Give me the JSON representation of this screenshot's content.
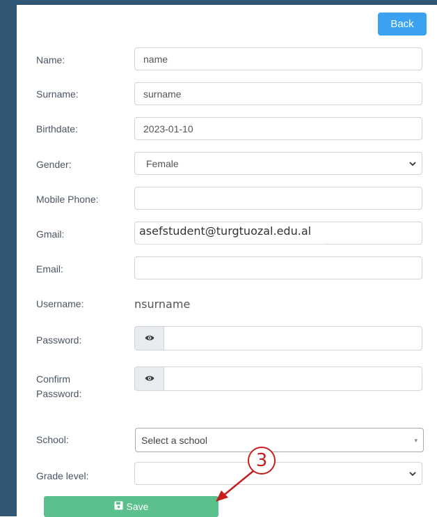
{
  "header": {
    "back_label": "Back"
  },
  "form": {
    "name": {
      "label": "Name:",
      "value": "name"
    },
    "surname": {
      "label": "Surname:",
      "value": "surname"
    },
    "birthdate": {
      "label": "Birthdate:",
      "value": "2023-01-10"
    },
    "gender": {
      "label": "Gender:",
      "value": "Female"
    },
    "mobile_phone": {
      "label": "Mobile Phone:",
      "value": ""
    },
    "gmail": {
      "label": "Gmail:",
      "value": "asefstudent@turgtuozal.edu.al"
    },
    "email": {
      "label": "Email:",
      "value": ""
    },
    "username": {
      "label": "Username:",
      "value": "nsurname"
    },
    "password": {
      "label": "Password:"
    },
    "confirm_password": {
      "label_line1": "Confirm",
      "label_line2": "Password:"
    },
    "school": {
      "label": "School:",
      "placeholder": "Select a school"
    },
    "grade_level": {
      "label": "Grade level:",
      "value": ""
    },
    "save_label": "Save"
  },
  "annotation": {
    "step": "3"
  },
  "colors": {
    "rail": "#2f5775",
    "back_button": "#3aa2f0",
    "save_button": "#5cc08c",
    "annotation": "#c41e1e"
  },
  "icons": {
    "eye": "eye-icon",
    "save": "floppy-disk-icon",
    "chevron": "chevron-down-icon"
  }
}
